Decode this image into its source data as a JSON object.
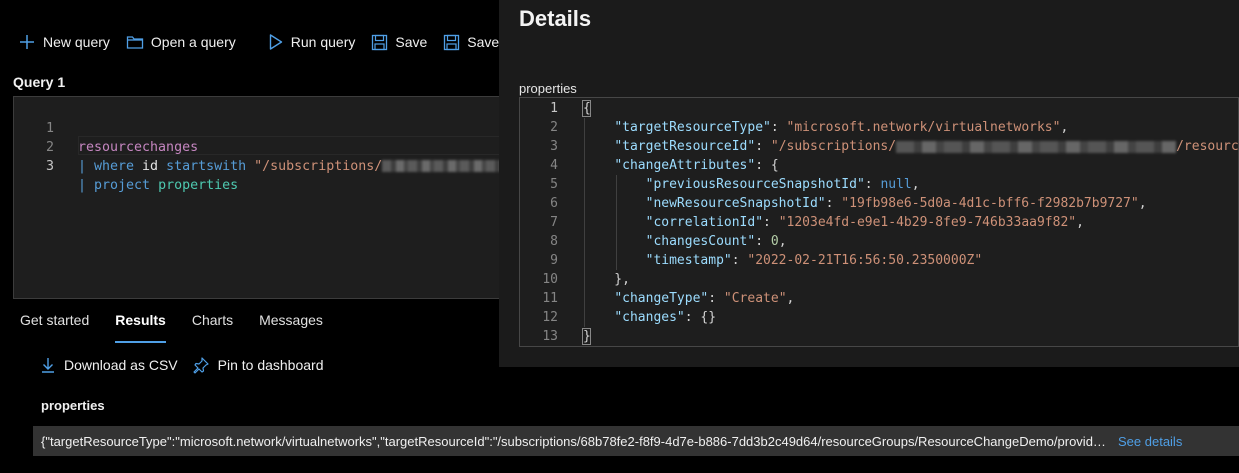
{
  "toolbar": {
    "new_query": "New query",
    "open_query": "Open a query",
    "run_query": "Run query",
    "save": "Save",
    "save_as": "Save as"
  },
  "query_tab": "Query 1",
  "editor": {
    "lines": [
      {
        "num": "1",
        "parts": [
          {
            "t": "resourcechanges",
            "c": "kw-table"
          }
        ]
      },
      {
        "num": "2",
        "parts": [
          {
            "t": "| ",
            "c": "pipe"
          },
          {
            "t": "where",
            "c": "kw-op"
          },
          {
            "t": " id ",
            "c": ""
          },
          {
            "t": "startswith",
            "c": "kw-op"
          },
          {
            "t": " \"/subscriptions/",
            "c": "kw-str"
          }
        ]
      },
      {
        "num": "3",
        "parts": [
          {
            "t": "| ",
            "c": "pipe"
          },
          {
            "t": "project",
            "c": "kw-op"
          },
          {
            "t": " properties",
            "c": "kw-prop"
          }
        ]
      }
    ]
  },
  "results": {
    "tabs": [
      "Get started",
      "Results",
      "Charts",
      "Messages"
    ],
    "active_tab": "Results",
    "download_csv": "Download as CSV",
    "pin_dashboard": "Pin to dashboard",
    "column_header": "properties",
    "row_value": "{\"targetResourceType\":\"microsoft.network/virtualnetworks\",\"targetResourceId\":\"/subscriptions/68b78fe2-f8f9-4d7e-b886-7dd3b2c49d64/resourceGroups/ResourceChangeDemo/providers/Microsoft.Network/virtualNetworks/vnet\"}",
    "see_details": "See details"
  },
  "details": {
    "title": "Details",
    "label": "properties",
    "lines": [
      "1",
      "2",
      "3",
      "4",
      "5",
      "6",
      "7",
      "8",
      "9",
      "10",
      "11",
      "12",
      "13"
    ],
    "json": {
      "targetResourceType": "microsoft.network/virtualnetworks",
      "targetResourceId_prefix": "/subscriptions/",
      "targetResourceId_suffix": "/resource",
      "previousResourceSnapshotId": "null",
      "newResourceSnapshotId": "19fb98e6-5d0a-4d1c-bff6-f2982b7b9727",
      "correlationId": "1203e4fd-e9e1-4b29-8fe9-746b33aa9f82",
      "changesCount": "0",
      "timestamp": "2022-02-21T16:56:50.2350000Z",
      "changeType": "Create"
    }
  },
  "colors": {
    "accent": "#4f9fe6",
    "panel_bg": "#1b1b1b"
  }
}
